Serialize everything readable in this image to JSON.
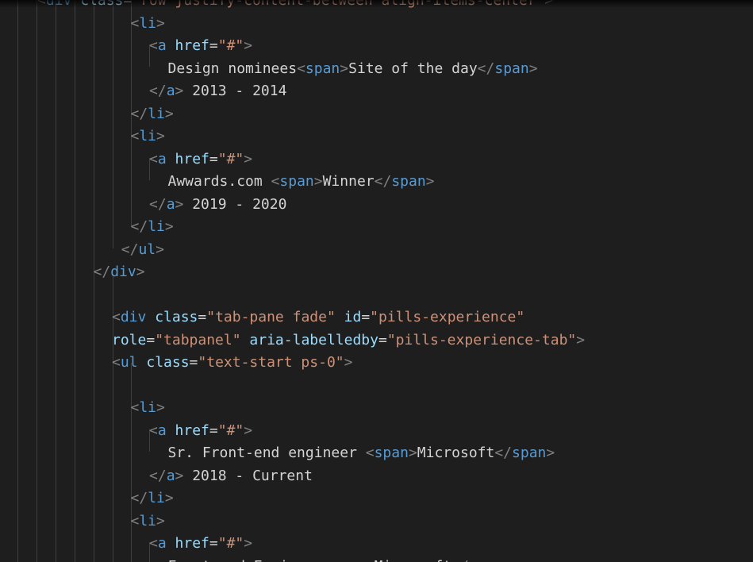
{
  "colors": {
    "background": "#1e1e1e",
    "punctuation": "#808080",
    "tag": "#569cd6",
    "attribute": "#9cdcfe",
    "string": "#ce9178",
    "text": "#d4d4d4",
    "indent_guide": "#404040"
  },
  "code_lines": [
    {
      "indent": 2,
      "tokens": [
        {
          "t": "<",
          "c": "punct"
        },
        {
          "t": "div ",
          "c": "tag"
        },
        {
          "t": "class",
          "c": "attr"
        },
        {
          "t": "=",
          "c": "text"
        },
        {
          "t": "\"row justify-content-between align-items-center\"",
          "c": "str"
        },
        {
          "t": ">",
          "c": "punct"
        }
      ]
    },
    {
      "indent": 7,
      "tokens": [
        {
          "t": "<",
          "c": "punct"
        },
        {
          "t": "li",
          "c": "tag"
        },
        {
          "t": ">",
          "c": "punct"
        }
      ]
    },
    {
      "indent": 8,
      "tokens": [
        {
          "t": "<",
          "c": "punct"
        },
        {
          "t": "a ",
          "c": "tag"
        },
        {
          "t": "href",
          "c": "attr"
        },
        {
          "t": "=",
          "c": "text"
        },
        {
          "t": "\"#\"",
          "c": "str"
        },
        {
          "t": ">",
          "c": "punct"
        }
      ]
    },
    {
      "indent": 9,
      "tokens": [
        {
          "t": "Design nominees",
          "c": "text"
        },
        {
          "t": "<",
          "c": "punct"
        },
        {
          "t": "span",
          "c": "tag"
        },
        {
          "t": ">",
          "c": "punct"
        },
        {
          "t": "Site of the day",
          "c": "text"
        },
        {
          "t": "</",
          "c": "punct"
        },
        {
          "t": "span",
          "c": "tag"
        },
        {
          "t": ">",
          "c": "punct"
        }
      ]
    },
    {
      "indent": 8,
      "tokens": [
        {
          "t": "</",
          "c": "punct"
        },
        {
          "t": "a",
          "c": "tag"
        },
        {
          "t": ">",
          "c": "punct"
        },
        {
          "t": " 2013 - 2014",
          "c": "text"
        }
      ]
    },
    {
      "indent": 7,
      "tokens": [
        {
          "t": "</",
          "c": "punct"
        },
        {
          "t": "li",
          "c": "tag"
        },
        {
          "t": ">",
          "c": "punct"
        }
      ]
    },
    {
      "indent": 7,
      "tokens": [
        {
          "t": "<",
          "c": "punct"
        },
        {
          "t": "li",
          "c": "tag"
        },
        {
          "t": ">",
          "c": "punct"
        }
      ]
    },
    {
      "indent": 8,
      "tokens": [
        {
          "t": "<",
          "c": "punct"
        },
        {
          "t": "a ",
          "c": "tag"
        },
        {
          "t": "href",
          "c": "attr"
        },
        {
          "t": "=",
          "c": "text"
        },
        {
          "t": "\"#\"",
          "c": "str"
        },
        {
          "t": ">",
          "c": "punct"
        }
      ]
    },
    {
      "indent": 9,
      "tokens": [
        {
          "t": "Awwards.com ",
          "c": "text"
        },
        {
          "t": "<",
          "c": "punct"
        },
        {
          "t": "span",
          "c": "tag"
        },
        {
          "t": ">",
          "c": "punct"
        },
        {
          "t": "Winner",
          "c": "text"
        },
        {
          "t": "</",
          "c": "punct"
        },
        {
          "t": "span",
          "c": "tag"
        },
        {
          "t": ">",
          "c": "punct"
        }
      ]
    },
    {
      "indent": 8,
      "tokens": [
        {
          "t": "</",
          "c": "punct"
        },
        {
          "t": "a",
          "c": "tag"
        },
        {
          "t": ">",
          "c": "punct"
        },
        {
          "t": " 2019 - 2020",
          "c": "text"
        }
      ]
    },
    {
      "indent": 7,
      "tokens": [
        {
          "t": "</",
          "c": "punct"
        },
        {
          "t": "li",
          "c": "tag"
        },
        {
          "t": ">",
          "c": "punct"
        }
      ]
    },
    {
      "indent": 6.5,
      "tokens": [
        {
          "t": "</",
          "c": "punct"
        },
        {
          "t": "ul",
          "c": "tag"
        },
        {
          "t": ">",
          "c": "punct"
        }
      ]
    },
    {
      "indent": 5,
      "tokens": [
        {
          "t": "</",
          "c": "punct"
        },
        {
          "t": "div",
          "c": "tag"
        },
        {
          "t": ">",
          "c": "punct"
        }
      ]
    },
    {
      "indent": 6,
      "tokens": []
    },
    {
      "indent": 6,
      "tokens": [
        {
          "t": "<",
          "c": "punct"
        },
        {
          "t": "div ",
          "c": "tag"
        },
        {
          "t": "class",
          "c": "attr"
        },
        {
          "t": "=",
          "c": "text"
        },
        {
          "t": "\"tab-pane fade\" ",
          "c": "str"
        },
        {
          "t": "id",
          "c": "attr"
        },
        {
          "t": "=",
          "c": "text"
        },
        {
          "t": "\"pills-experience\"",
          "c": "str"
        }
      ]
    },
    {
      "indent": 6,
      "tokens": [
        {
          "t": "role",
          "c": "attr"
        },
        {
          "t": "=",
          "c": "text"
        },
        {
          "t": "\"tabpanel\" ",
          "c": "str"
        },
        {
          "t": "aria-labelledby",
          "c": "attr"
        },
        {
          "t": "=",
          "c": "text"
        },
        {
          "t": "\"pills-experience-tab\"",
          "c": "str"
        },
        {
          "t": ">",
          "c": "punct"
        }
      ]
    },
    {
      "indent": 6,
      "tokens": [
        {
          "t": "<",
          "c": "punct"
        },
        {
          "t": "ul ",
          "c": "tag"
        },
        {
          "t": "class",
          "c": "attr"
        },
        {
          "t": "=",
          "c": "text"
        },
        {
          "t": "\"text-start ps-0\"",
          "c": "str"
        },
        {
          "t": ">",
          "c": "punct"
        }
      ]
    },
    {
      "indent": 7,
      "tokens": []
    },
    {
      "indent": 7,
      "tokens": [
        {
          "t": "<",
          "c": "punct"
        },
        {
          "t": "li",
          "c": "tag"
        },
        {
          "t": ">",
          "c": "punct"
        }
      ]
    },
    {
      "indent": 8,
      "tokens": [
        {
          "t": "<",
          "c": "punct"
        },
        {
          "t": "a ",
          "c": "tag"
        },
        {
          "t": "href",
          "c": "attr"
        },
        {
          "t": "=",
          "c": "text"
        },
        {
          "t": "\"#\"",
          "c": "str"
        },
        {
          "t": ">",
          "c": "punct"
        }
      ]
    },
    {
      "indent": 9,
      "tokens": [
        {
          "t": "Sr. Front-end engineer ",
          "c": "text"
        },
        {
          "t": "<",
          "c": "punct"
        },
        {
          "t": "span",
          "c": "tag"
        },
        {
          "t": ">",
          "c": "punct"
        },
        {
          "t": "Microsoft",
          "c": "text"
        },
        {
          "t": "</",
          "c": "punct"
        },
        {
          "t": "span",
          "c": "tag"
        },
        {
          "t": ">",
          "c": "punct"
        }
      ]
    },
    {
      "indent": 8,
      "tokens": [
        {
          "t": "</",
          "c": "punct"
        },
        {
          "t": "a",
          "c": "tag"
        },
        {
          "t": ">",
          "c": "punct"
        },
        {
          "t": " 2018 - Current",
          "c": "text"
        }
      ]
    },
    {
      "indent": 7,
      "tokens": [
        {
          "t": "</",
          "c": "punct"
        },
        {
          "t": "li",
          "c": "tag"
        },
        {
          "t": ">",
          "c": "punct"
        }
      ]
    },
    {
      "indent": 7,
      "tokens": [
        {
          "t": "<",
          "c": "punct"
        },
        {
          "t": "li",
          "c": "tag"
        },
        {
          "t": ">",
          "c": "punct"
        }
      ]
    },
    {
      "indent": 8,
      "tokens": [
        {
          "t": "<",
          "c": "punct"
        },
        {
          "t": "a ",
          "c": "tag"
        },
        {
          "t": "href",
          "c": "attr"
        },
        {
          "t": "=",
          "c": "text"
        },
        {
          "t": "\"#\"",
          "c": "str"
        },
        {
          "t": ">",
          "c": "punct"
        }
      ]
    },
    {
      "indent": 9,
      "tokens": [
        {
          "t": "Front-end Engineer",
          "c": "text"
        },
        {
          "t": "<",
          "c": "punct"
        },
        {
          "t": "span",
          "c": "tag"
        },
        {
          "t": ">",
          "c": "punct"
        },
        {
          "t": "Microsoft",
          "c": "text"
        },
        {
          "t": "</",
          "c": "punct"
        },
        {
          "t": "span",
          "c": "tag"
        },
        {
          "t": ">",
          "c": "punct"
        }
      ]
    }
  ]
}
